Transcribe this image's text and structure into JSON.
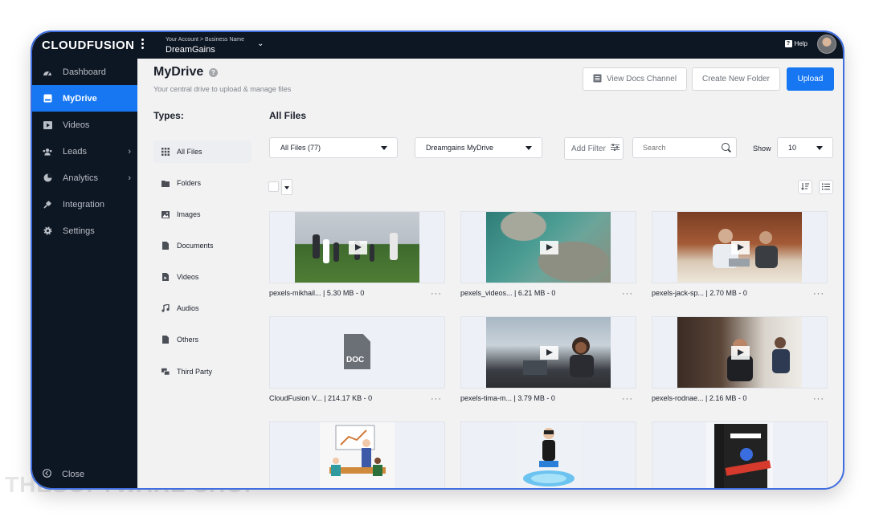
{
  "topbar": {
    "logo": "CLOUDFUSION",
    "account_sub": "Your Account > Business Name",
    "account_name": "DreamGains",
    "help": "Help"
  },
  "sidebar": {
    "items": [
      {
        "label": "Dashboard",
        "icon": "dashboard-icon"
      },
      {
        "label": "MyDrive",
        "icon": "drive-icon",
        "active": true
      },
      {
        "label": "Videos",
        "icon": "video-icon"
      },
      {
        "label": "Leads",
        "icon": "users-icon"
      },
      {
        "label": "Analytics",
        "icon": "pie-chart-icon"
      },
      {
        "label": "Integration",
        "icon": "plug-icon"
      },
      {
        "label": "Settings",
        "icon": "gear-icon"
      }
    ],
    "close": "Close"
  },
  "header": {
    "title": "MyDrive",
    "subtitle": "Your central drive to upload & manage files",
    "view_docs": "View Docs Channel",
    "create_folder": "Create New Folder",
    "upload": "Upload"
  },
  "types": {
    "heading": "Types:",
    "items": [
      "All Files",
      "Folders",
      "Images",
      "Documents",
      "Videos",
      "Audios",
      "Others",
      "Third Party"
    ]
  },
  "files": {
    "heading": "All Files",
    "filter_type": "All Files (77)",
    "drive_select": "Dreamgains MyDrive",
    "add_filter": "Add Filter",
    "search_placeholder": "Search",
    "show_label": "Show",
    "show_value": "10",
    "cards": [
      {
        "name": "pexels-mikhail... | 5.30 MB - 0",
        "kind": "video"
      },
      {
        "name": "pexels_videos... | 6.21 MB - 0",
        "kind": "video"
      },
      {
        "name": "pexels-jack-sp... | 2.70 MB - 0",
        "kind": "video"
      },
      {
        "name": "CloudFusion V... | 214.17 KB - 0",
        "kind": "doc",
        "doc_label": "DOC"
      },
      {
        "name": "pexels-tima-m... | 3.79 MB - 0",
        "kind": "video"
      },
      {
        "name": "pexels-rodnae... | 2.16 MB - 0",
        "kind": "video"
      },
      {
        "name": "",
        "kind": "image"
      },
      {
        "name": "",
        "kind": "image"
      },
      {
        "name": "",
        "kind": "image"
      }
    ]
  },
  "colors": {
    "accent": "#1777f2",
    "sidebar_bg": "#0d1623",
    "frame_border": "#3f6ee0"
  },
  "watermark": "THESOFTWARE SHOP"
}
